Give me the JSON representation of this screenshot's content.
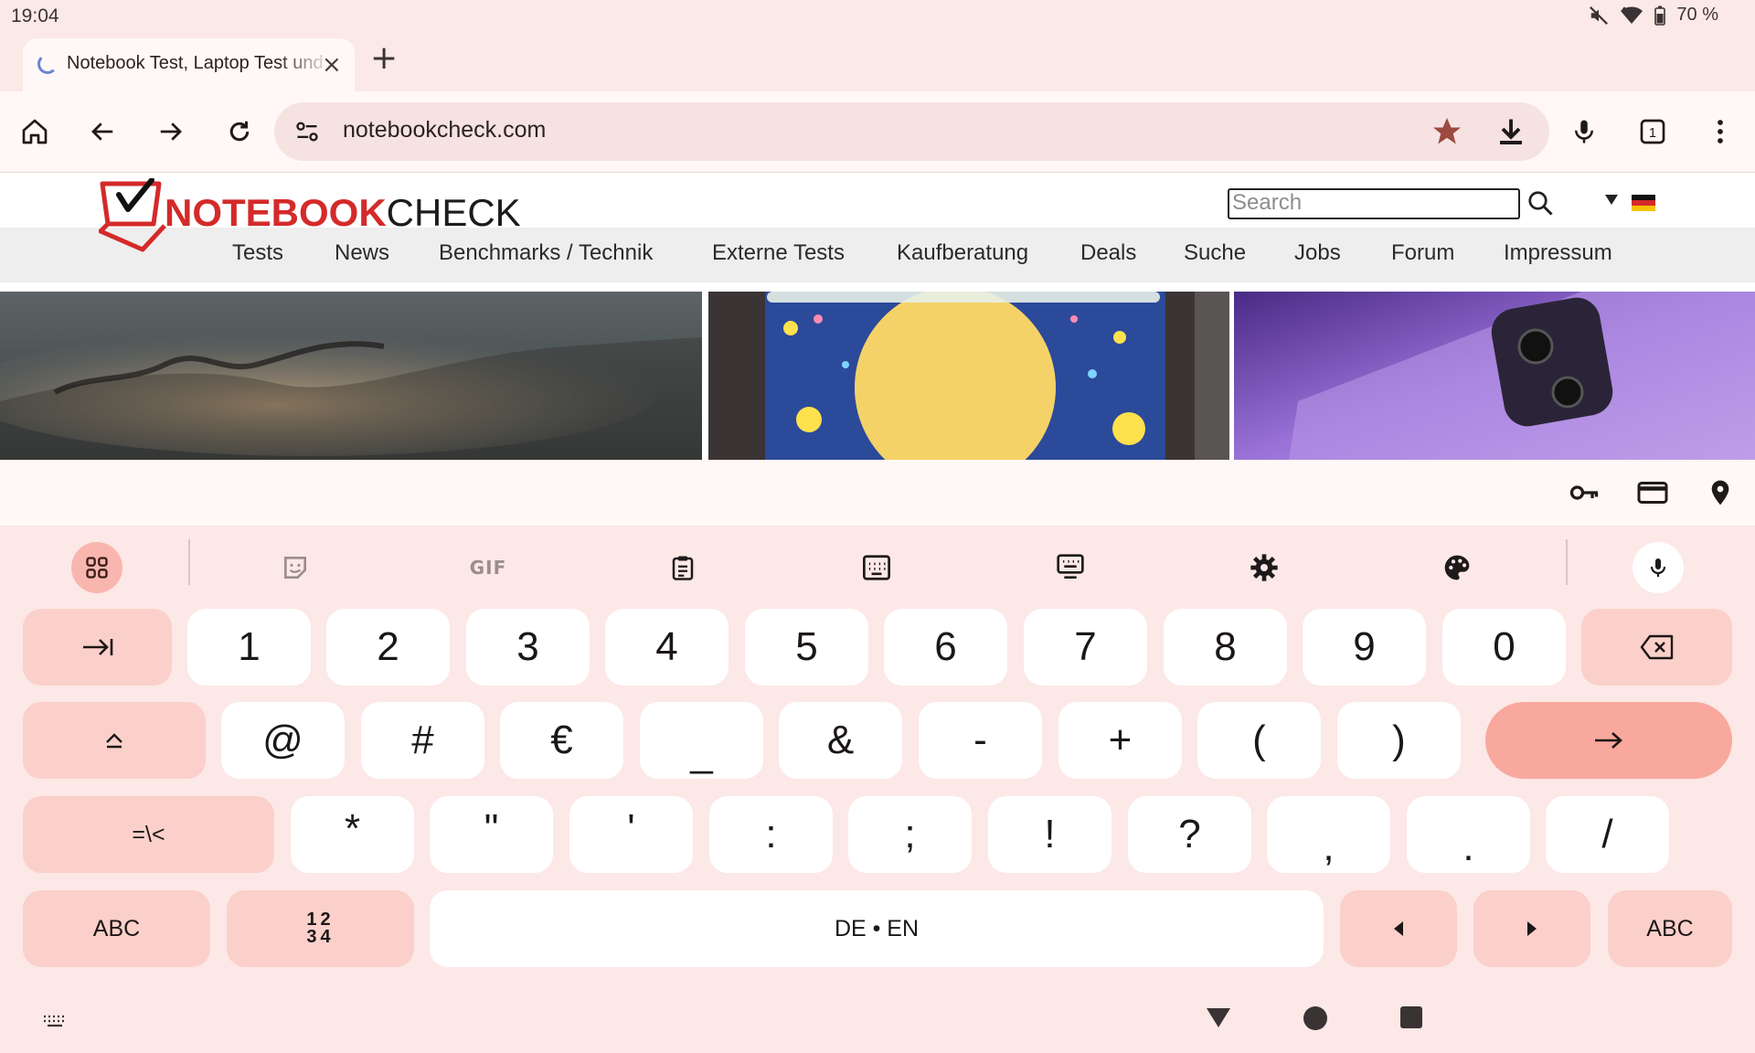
{
  "status": {
    "time": "19:04",
    "battery": "70 %"
  },
  "tab": {
    "title": "Notebook Test, Laptop Test und News",
    "close_glyph": "×",
    "new_tab_glyph": "+"
  },
  "omnibox": {
    "url": "notebookcheck.com"
  },
  "site": {
    "logo_part1": "NOTEBOOK",
    "logo_part2": "CHECK",
    "search_placeholder": "Search",
    "nav": [
      "Tests",
      "News",
      "Benchmarks / Technik",
      "Externe Tests",
      "Kaufberatung",
      "Deals",
      "Suche",
      "Jobs",
      "Forum",
      "Impressum"
    ]
  },
  "keyboard": {
    "row1": [
      "1",
      "2",
      "3",
      "4",
      "5",
      "6",
      "7",
      "8",
      "9",
      "0"
    ],
    "row2": [
      "@",
      "#",
      "€",
      "_",
      "&",
      "-",
      "+",
      "(",
      ")"
    ],
    "row3": [
      "*",
      "\"",
      "'",
      ":",
      ";",
      "!",
      "?",
      ",",
      ".",
      "/"
    ],
    "symbols_label": "=\\<",
    "abc_left": "ABC",
    "numpad_label": "12\n34",
    "space_label": "DE • EN",
    "abc_right": "ABC",
    "toolbar_gif": "GIF"
  },
  "colors": {
    "accent_key": "#f8a89d",
    "function_key": "#fbd0ca",
    "logo_red": "#d42a2a"
  }
}
